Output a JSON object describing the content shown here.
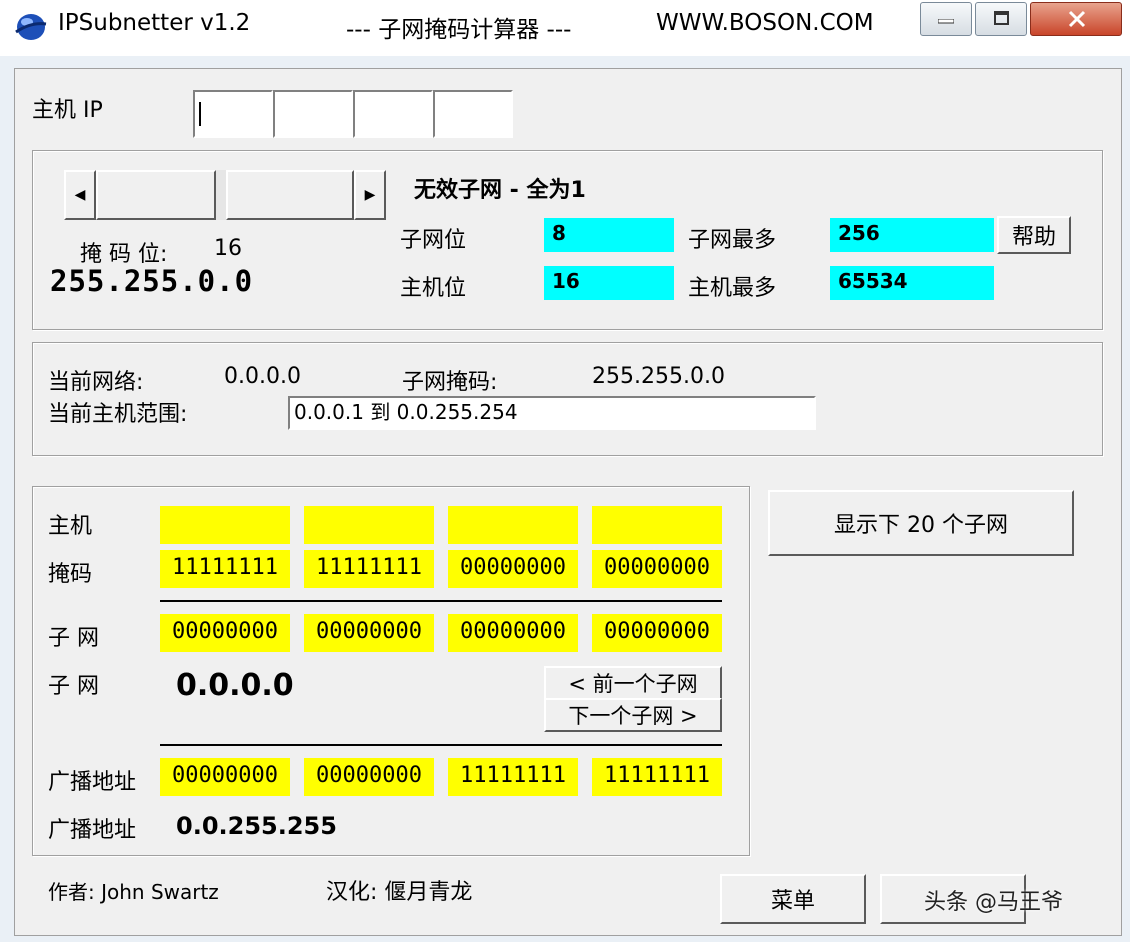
{
  "window": {
    "app_title": "IPSubnetter v1.2",
    "subtitle": "--- 子网掩码计算器 ---",
    "website": "WWW.BOSON.COM"
  },
  "host_ip": {
    "label": "主机 IP",
    "octets": [
      "",
      "",
      "",
      ""
    ]
  },
  "mask": {
    "bits_label": "掩 码 位:",
    "bits_value": "16",
    "mask_value": "255.255.0.0",
    "status": "无效子网 - 全为1",
    "subnet_bits_label": "子网位",
    "subnet_bits_value": "8",
    "max_subnets_label": "子网最多",
    "max_subnets_value": "256",
    "host_bits_label": "主机位",
    "host_bits_value": "16",
    "max_hosts_label": "主机最多",
    "max_hosts_value": "65534",
    "help_button": "帮助"
  },
  "network": {
    "current_network_label": "当前网络:",
    "current_network_value": "0.0.0.0",
    "subnet_mask_label": "子网掩码:",
    "subnet_mask_value": "255.255.0.0",
    "host_range_label": "当前主机范围:",
    "host_range_value": "0.0.0.1  到  0.0.255.254"
  },
  "binary": {
    "host_label": "主机",
    "host_octets": [
      "",
      "",
      "",
      ""
    ],
    "mask_label": "掩码",
    "mask_octets": [
      "11111111",
      "11111111",
      "00000000",
      "00000000"
    ],
    "subnet_label": "子 网",
    "subnet_octets": [
      "00000000",
      "00000000",
      "00000000",
      "00000000"
    ],
    "subnet_dec_label": "子 网",
    "subnet_dec_value": "0.0.0.0",
    "prev_button": "< 前一个子网",
    "next_button": "下一个子网 >",
    "broadcast_label": "广播地址",
    "broadcast_octets": [
      "00000000",
      "00000000",
      "11111111",
      "11111111"
    ],
    "broadcast_dec_label": "广播地址",
    "broadcast_dec_value": "0.0.255.255"
  },
  "show_next_button": "显示下 20 个子网",
  "footer": {
    "author": "作者: John Swartz",
    "translator": "汉化: 偃月青龙",
    "menu_button": "菜单",
    "watermark": "头条 @马王爷"
  },
  "colors": {
    "cyan_field": "#00ffff",
    "yellow_field": "#ffff00",
    "close_button": "#c9452a"
  }
}
